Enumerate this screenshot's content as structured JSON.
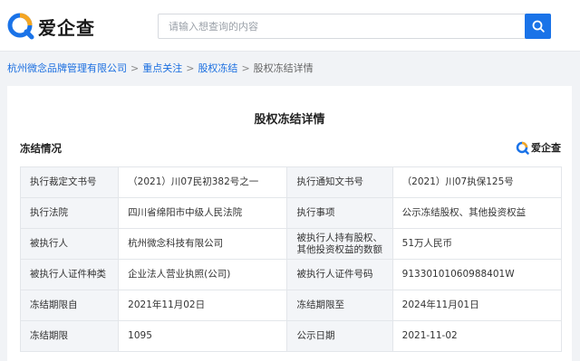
{
  "brand": {
    "name": "爱企查",
    "badge_name": "爱企查",
    "accent": "#1a73e8"
  },
  "search": {
    "placeholder": "请输入想查询的内容",
    "button_icon": "search-icon"
  },
  "breadcrumb": {
    "items": [
      "杭州微念品牌管理有限公司",
      "重点关注",
      "股权冻结"
    ],
    "current": "股权冻结详情",
    "separator": ">"
  },
  "page": {
    "title": "股权冻结详情",
    "section_title": "冻结情况"
  },
  "table": {
    "rows": [
      {
        "l1": "执行裁定文书号",
        "v1": "（2021）川07民初382号之一",
        "l2": "执行通知文书号",
        "v2": "（2021）川07执保125号"
      },
      {
        "l1": "执行法院",
        "v1": "四川省绵阳市中级人民法院",
        "l2": "执行事项",
        "v2": "公示冻结股权、其他投资权益"
      },
      {
        "l1": "被执行人",
        "v1": "杭州微念科技有限公司",
        "l2": "被执行人持有股权、其他投资权益的数额",
        "v2": "51万人民币"
      },
      {
        "l1": "被执行人证件种类",
        "v1": "企业法人营业执照(公司)",
        "l2": "被执行人证件号码",
        "v2": "91330101060988401W"
      },
      {
        "l1": "冻结期限自",
        "v1": "2021年11月02日",
        "l2": "冻结期限至",
        "v2": "2024年11月01日"
      },
      {
        "l1": "冻结期限",
        "v1": "1095",
        "l2": "公示日期",
        "v2": "2021-11-02"
      }
    ]
  }
}
